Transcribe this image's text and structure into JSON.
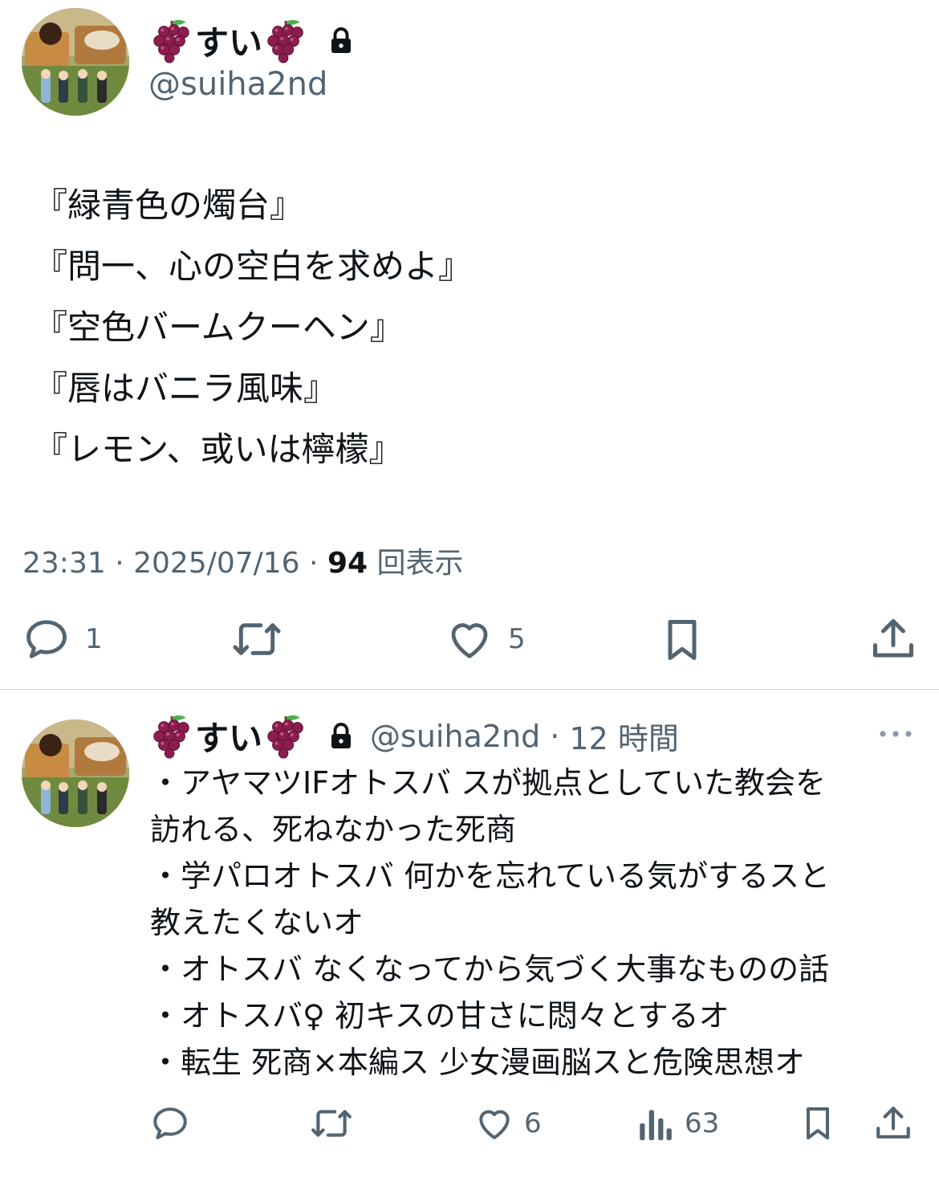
{
  "main_tweet": {
    "author_name": "すい",
    "author_handle": "@suiha2nd",
    "lines": [
      "『緑青色の燭台』",
      "『問一、心の空白を求めよ』",
      "『空色バームクーヘン』",
      "『唇はバニラ風味』",
      "『レモン、或いは檸檬』"
    ],
    "time": "23:31",
    "date": "2025/07/16",
    "views_count": "94",
    "views_label": "回表示",
    "replies": "1",
    "retweets": "",
    "likes": "5"
  },
  "reply_tweet": {
    "author_name": "すい",
    "author_handle": "@suiha2nd",
    "time_ago": "12 時間",
    "lines": [
      "・アヤマツIFオトスバ スが拠点としていた教会を",
      "訪れる、死ねなかった死商",
      "・学パロオトスバ 何かを忘れている気がするスと",
      "教えたくないオ",
      "・オトスバ なくなってから気づく大事なものの話",
      "・オトスバ♀ 初キスの甘さに悶々とするオ",
      "・転生 死商×本編ス 少女漫画脳スと危険思想オ"
    ],
    "replies": "",
    "retweets": "",
    "likes": "6",
    "views": "63"
  },
  "icons": {
    "emoji": "grape-emoji",
    "lock": "lock-icon",
    "reply": "reply-icon",
    "retweet": "retweet-icon",
    "like": "heart-icon",
    "bookmark": "bookmark-icon",
    "share": "share-icon",
    "views": "views-icon",
    "more": "more-icon"
  },
  "colors": {
    "text": "#0f1419",
    "secondary": "#536471",
    "divider": "#cfd9de",
    "grape": "#7b1f4a"
  }
}
